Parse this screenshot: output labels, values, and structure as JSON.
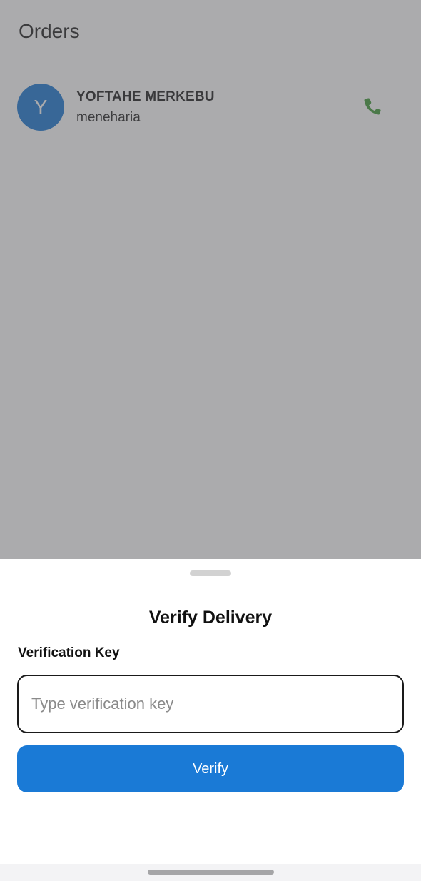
{
  "header": {
    "title": "Orders"
  },
  "orders": [
    {
      "avatar_letter": "Y",
      "name": "YOFTAHE MERKEBU",
      "subtitle": "meneharia",
      "call_icon": "phone-icon"
    }
  ],
  "verify_sheet": {
    "title": "Verify Delivery",
    "field_label": "Verification Key",
    "input_value": "",
    "input_placeholder": "Type verification key",
    "button_label": "Verify"
  },
  "colors": {
    "accent": "#1A7AD6",
    "avatar": "#1976D2",
    "call_icon": "#3E9A36",
    "scrim": "#57575B"
  }
}
